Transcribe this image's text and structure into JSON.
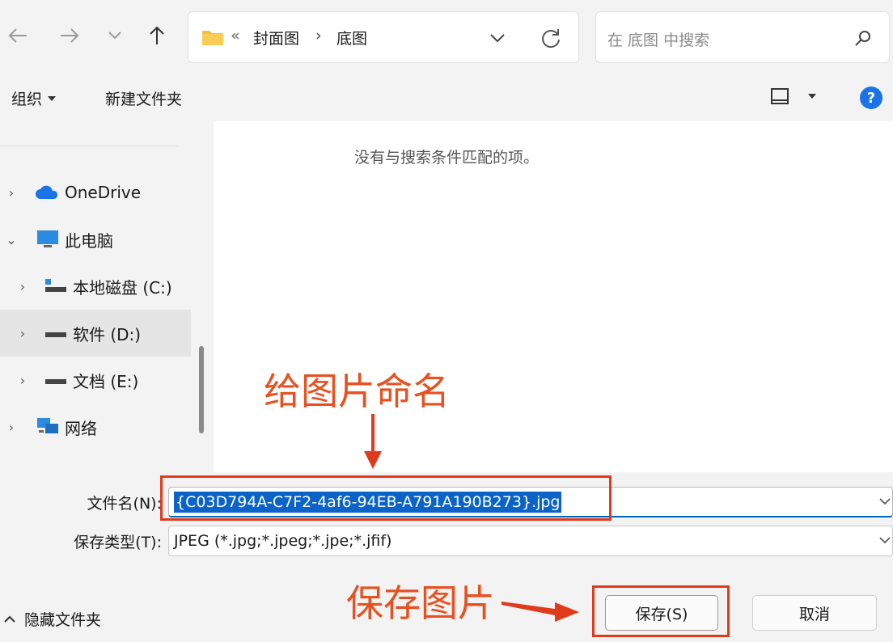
{
  "nav": {
    "breadcrumb_separator": "«",
    "breadcrumb": [
      "封面图",
      "底图"
    ],
    "search_placeholder": "在 底图 中搜索"
  },
  "command_bar": {
    "organize_label": "组织",
    "new_folder_label": "新建文件夹"
  },
  "sidebar": {
    "items": [
      {
        "label": "OneDrive",
        "chevron": "›",
        "icon": "cloud-icon"
      },
      {
        "label": "此电脑",
        "chevron": "⌄",
        "icon": "monitor-icon"
      },
      {
        "label": "本地磁盘 (C:)",
        "chevron": "›",
        "icon": "drive-icon"
      },
      {
        "label": "软件 (D:)",
        "chevron": "›",
        "icon": "drive-icon",
        "selected": true
      },
      {
        "label": "文档 (E:)",
        "chevron": "›",
        "icon": "drive-icon"
      },
      {
        "label": "网络",
        "chevron": "›",
        "icon": "network-icon"
      }
    ]
  },
  "content": {
    "empty_message": "没有与搜索条件匹配的项。"
  },
  "form": {
    "filename_label": "文件名(N):",
    "filename_value": "{C03D794A-C7F2-4af6-94EB-A791A190B273}.jpg",
    "filetype_label": "保存类型(T):",
    "filetype_value": "JPEG (*.jpg;*.jpeg;*.jpe;*.jfif)",
    "hide_folders_label": "隐藏文件夹",
    "save_label": "保存(S)",
    "cancel_label": "取消"
  },
  "annotations": {
    "name_image": "给图片命名",
    "save_image": "保存图片",
    "color": "#e03a1c"
  },
  "colors": {
    "accent": "#0067c0",
    "selection": "#0a63c9",
    "help": "#1a73e8",
    "folder": "#f4c042"
  }
}
